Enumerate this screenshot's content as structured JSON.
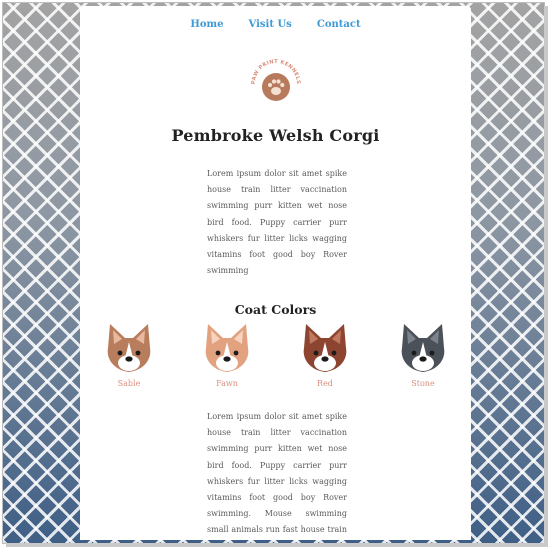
{
  "nav": {
    "items": [
      "Home",
      "Visit Us",
      "Contact"
    ]
  },
  "logo": {
    "text": "PAW PRINT KENNELS",
    "icon": "paw-icon"
  },
  "page_title": "Pembroke Welsh Corgi",
  "intro_paragraph": "Lorem ipsum dolor sit amet spike house train litter vaccination swimming purr kitten wet nose bird food. Puppy carrier purr whiskers fur litter licks wagging vitamins foot good boy Rover swimming",
  "coat_colors": {
    "heading": "Coat Colors",
    "items": [
      {
        "label": "Sable",
        "color": "#b87d5c"
      },
      {
        "label": "Fawn",
        "color": "#e3a27f"
      },
      {
        "label": "Red",
        "color": "#8d4531"
      },
      {
        "label": "Stone",
        "color": "#4b5159"
      }
    ]
  },
  "second_paragraph": "Lorem ipsum dolor sit amet spike house train litter vaccination swimming purr kitten wet nose bird food. Puppy carrier purr whiskers fur litter licks wagging vitamins foot good boy Rover swimming. Mouse swimming small animals run fast house train bird food fetch. Meow scratch ball kitten wet nose"
}
